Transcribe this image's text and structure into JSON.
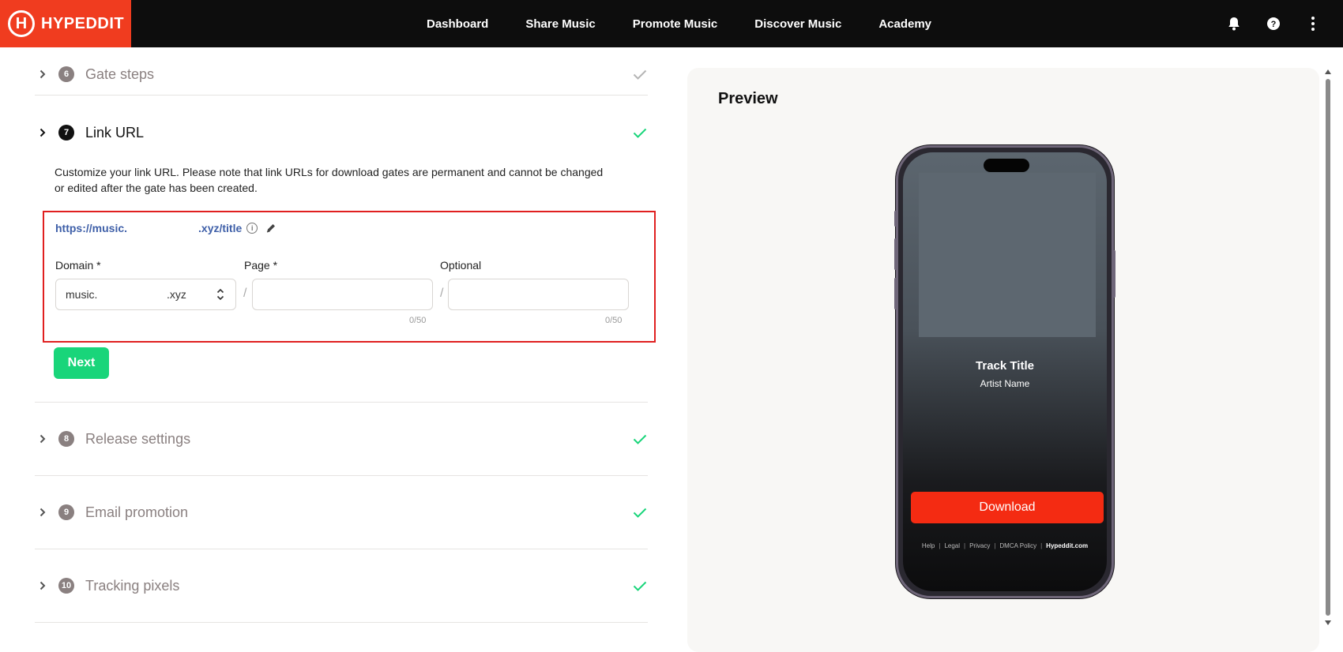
{
  "header": {
    "logo_text": "HYPEDDIT",
    "nav": [
      "Dashboard",
      "Share Music",
      "Promote Music",
      "Discover Music",
      "Academy"
    ]
  },
  "steps": {
    "gate_steps": {
      "number": "6",
      "title": "Gate steps"
    },
    "link_url": {
      "number": "7",
      "title": "Link URL"
    },
    "release_settings": {
      "number": "8",
      "title": "Release settings"
    },
    "email_promotion": {
      "number": "9",
      "title": "Email promotion"
    },
    "tracking_pixels": {
      "number": "10",
      "title": "Tracking pixels"
    }
  },
  "link_url": {
    "description": "Customize your link URL. Please note that link URLs for download gates are permanent and cannot be changed or edited after the gate has been created.",
    "url_prefix": "https://music.",
    "url_suffix": ".xyz/title",
    "domain_label": "Domain *",
    "domain_value": "music.",
    "domain_suffix": ".xyz",
    "page_label": "Page *",
    "page_value": "",
    "page_counter": "0/50",
    "optional_label": "Optional",
    "optional_value": "",
    "optional_counter": "0/50",
    "separator": "/",
    "next_label": "Next"
  },
  "preview": {
    "title": "Preview",
    "track_title": "Track Title",
    "artist_name": "Artist Name",
    "download_label": "Download",
    "footer_links": [
      "Help",
      "Legal",
      "Privacy",
      "DMCA Policy"
    ],
    "footer_brand": "Hypeddit.com"
  },
  "colors": {
    "brand": "#f03c1f",
    "next": "#19d57a",
    "download": "#f42b12",
    "check": "#19d57a"
  }
}
